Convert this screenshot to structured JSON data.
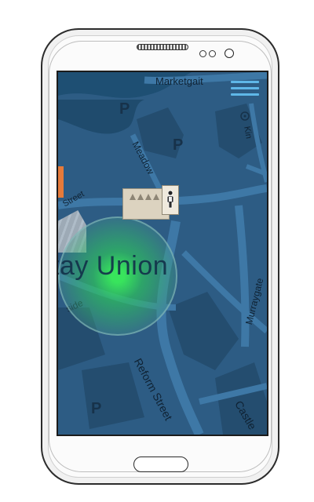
{
  "map": {
    "streets": {
      "marketgait": "Marketgait",
      "kin": "Kin",
      "meadow": "Meadow",
      "street_upper_left": "Street",
      "murraygate": "Murraygate",
      "reform_street": "Reform Street",
      "riverside": "side",
      "castle": "Castle"
    },
    "area_label": "tay Union",
    "parking_label": "P"
  },
  "colors": {
    "map_water": "#1e4f73",
    "map_land": "#2d5c84",
    "map_road": "#3e78a6",
    "map_building": "#244d6f",
    "accent_menu": "#5fb7e8",
    "location_green": "#39eb5a"
  },
  "icons": {
    "menu": "hamburger-menu-icon",
    "person": "person-icon",
    "locate": "target-icon"
  }
}
